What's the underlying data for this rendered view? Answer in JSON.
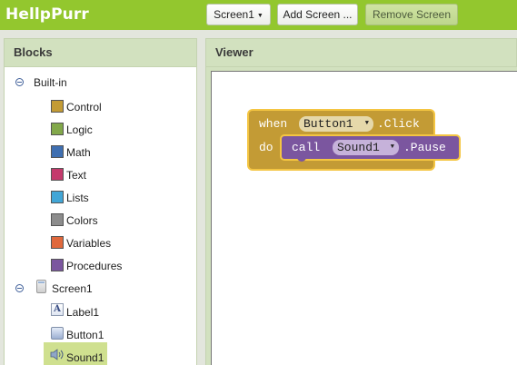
{
  "app": {
    "title": "HellpPurr"
  },
  "toolbar": {
    "screen_selector": "Screen1",
    "add_screen_label": "Add Screen ...",
    "remove_screen_label": "Remove Screen"
  },
  "blocks_panel": {
    "title": "Blocks",
    "builtin": {
      "label": "Built-in",
      "items": [
        {
          "label": "Control",
          "color": "#c39b35"
        },
        {
          "label": "Logic",
          "color": "#82a84a"
        },
        {
          "label": "Math",
          "color": "#3f6fb1"
        },
        {
          "label": "Text",
          "color": "#c43a6c"
        },
        {
          "label": "Lists",
          "color": "#42a6d6"
        },
        {
          "label": "Colors",
          "color": "#8c8c8c"
        },
        {
          "label": "Variables",
          "color": "#e0683c"
        },
        {
          "label": "Procedures",
          "color": "#7b569f"
        }
      ]
    },
    "screen": {
      "label": "Screen1",
      "components": [
        {
          "label": "Label1",
          "icon": "label-icon"
        },
        {
          "label": "Button1",
          "icon": "button-icon"
        },
        {
          "label": "Sound1",
          "icon": "speaker-icon",
          "selected": true
        }
      ]
    }
  },
  "viewer_panel": {
    "title": "Viewer",
    "event_block": {
      "when_label": "when",
      "component": "Button1",
      "event": ".Click",
      "do_label": "do"
    },
    "call_block": {
      "call_label": "call",
      "component": "Sound1",
      "method": ".Pause"
    }
  }
}
